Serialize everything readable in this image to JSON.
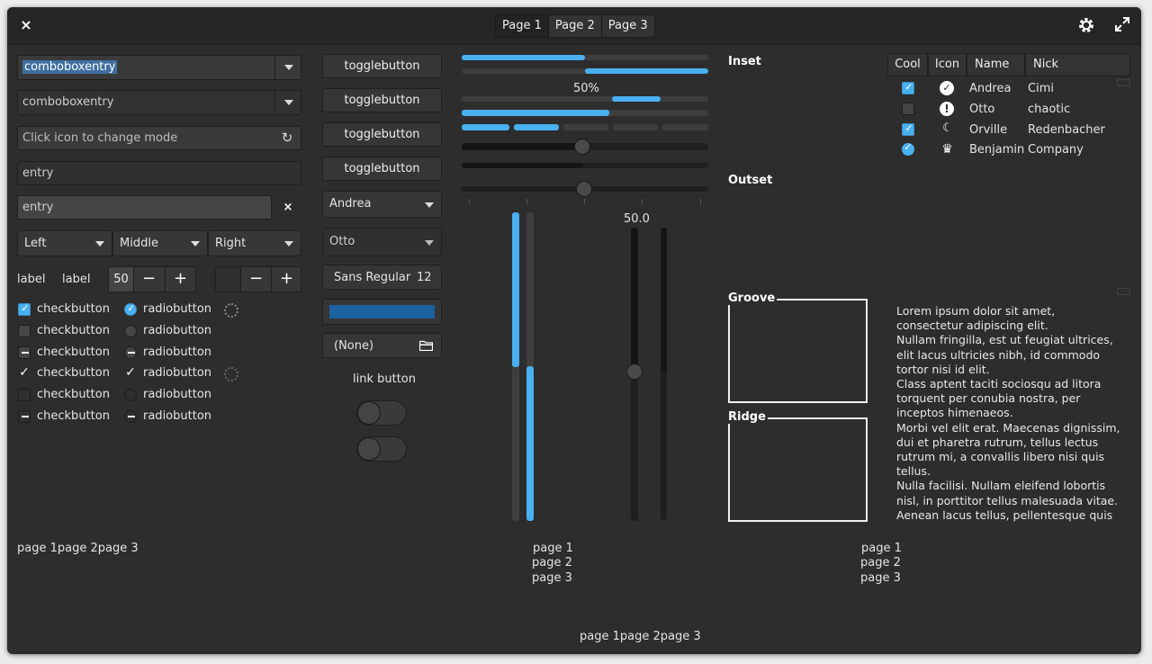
{
  "header": {
    "close_glyph": "×",
    "tabs": [
      {
        "label": "Page 1"
      },
      {
        "label": "Page 2"
      },
      {
        "label": "Page 3"
      }
    ],
    "settings_icon": "gear-icon",
    "maximize_icon": "maximize-icon"
  },
  "left": {
    "combo1_value": "comboboxentry",
    "combo2_value": "comboboxentry",
    "mode_entry_placeholder": "Click icon to change mode",
    "entry1_value": "entry",
    "entry2_value": "entry",
    "segmented": [
      "Left",
      "Middle",
      "Right"
    ],
    "label1": "label",
    "label2": "label",
    "spin_value": "50",
    "minus": "−",
    "plus": "+",
    "checkbuttons": [
      "checkbutton",
      "checkbutton",
      "checkbutton",
      "checkbutton",
      "checkbutton",
      "checkbutton"
    ],
    "radiobuttons": [
      "radiobutton",
      "radiobutton",
      "radiobutton",
      "radiobutton",
      "radiobutton",
      "radiobutton"
    ],
    "pages_inline": "page 1page 2page 3"
  },
  "middle": {
    "togglebuttons": [
      "togglebutton",
      "togglebutton",
      "togglebutton",
      "togglebutton"
    ],
    "combo_andrea": "Andrea",
    "combo_otto": "Otto",
    "font_name": "Sans Regular",
    "font_size": "12",
    "color_value": "#1c62a0",
    "file_none": "(None)",
    "link_button": "link button"
  },
  "progress": {
    "label": "50%",
    "bar1_fraction": 0.5,
    "bar2_fraction": 0.5,
    "bar3_fraction": 0.75,
    "slider_value_label": "50.0",
    "vertical_pages": [
      "page 1",
      "page 2",
      "page 3"
    ]
  },
  "frames": {
    "inset": "Inset",
    "outset": "Outset",
    "groove": "Groove",
    "ridge": "Ridge"
  },
  "tree": {
    "columns": [
      "Cool",
      "Icon",
      "Name",
      "Nick"
    ],
    "rows": [
      {
        "cool": true,
        "icon": "check-circle-icon",
        "name": "Andrea",
        "nick": "Cimi"
      },
      {
        "cool": false,
        "icon": "exclamation-circle-icon",
        "name": "Otto",
        "nick": "chaotic"
      },
      {
        "cool": true,
        "icon": "moon-icon",
        "name": "Orville",
        "nick": "Redenbacher"
      },
      {
        "cool": true,
        "icon": "crown-icon",
        "name": "Benjamin",
        "nick": "Company"
      }
    ]
  },
  "lorem": [
    "Lorem ipsum dolor sit amet, consectetur adipiscing elit.",
    "Nullam fringilla, est ut feugiat ultrices, elit lacus ultricies nibh, id commodo tortor nisi id elit.",
    "Class aptent taciti sociosqu ad litora torquent per conubia nostra, per inceptos himenaeos.",
    "Morbi vel elit erat. Maecenas dignissim, dui et pharetra rutrum, tellus lectus rutrum mi, a convallis libero nisi quis tellus.",
    "Nulla facilisi. Nullam eleifend lobortis nisl, in porttitor tellus malesuada vitae.",
    "Aenean lacus tellus, pellentesque quis"
  ],
  "right_pages": [
    "page 1",
    "page 2",
    "page 3"
  ],
  "bottom_pages_inline": "page 1page 2page 3"
}
